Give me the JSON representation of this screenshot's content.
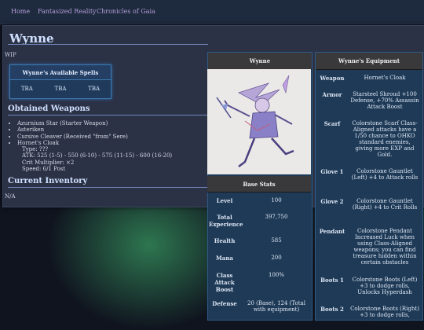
{
  "nav": {
    "items": [
      "Home",
      "Fantasized Reality",
      "Chronicles of Gaia"
    ]
  },
  "page": {
    "title": "Wynne",
    "wip": "WIP",
    "spells": {
      "heading": "Wynne's Available Spells",
      "slots": [
        "TBA",
        "TBA",
        "TBA"
      ]
    },
    "weapons_heading": "Obtained Weapons",
    "weapons": [
      "Azurnium Star (Starter Weapon)",
      "Asteriken",
      "Cursive Cleaver (Received \"from\" Sere)",
      "Hornet's Cloak"
    ],
    "weapon_details": [
      "Type: ???",
      "ATK: 525 (1-5) - 550 (6-10) - 575 (11-15) - 600 (16-20)",
      "Crit Multiplier: ×2",
      "Speed: 6/1 Post"
    ],
    "inventory_heading": "Current Inventory",
    "inventory_value": "N/A"
  },
  "character": {
    "heading": "Wynne",
    "stats_heading": "Base Stats",
    "stats": [
      {
        "label": "Level",
        "value": "100"
      },
      {
        "label": "Total Experience",
        "value": "397,750"
      },
      {
        "label": "Health",
        "value": "585"
      },
      {
        "label": "Mana",
        "value": "200"
      },
      {
        "label": "Class Attack Boost",
        "value": "100%"
      },
      {
        "label": "Defense",
        "value": "20 (Base), 124 (Total with equipment)"
      }
    ]
  },
  "equipment": {
    "heading": "Wynne's Equipment",
    "rows": [
      {
        "label": "Weapon",
        "value": "Hornet's Cloak"
      },
      {
        "label": "Armor",
        "value": "Starsteel Shroud +100 Defense, +70% Assassin Attack Boost"
      },
      {
        "label": "Scarf",
        "value": "Colorstone Scarf Class-Aligned attacks have a 1/50 chance to OHKO standard enemies, giving more EXP and Gold."
      },
      {
        "label": "Glove 1",
        "value": "Colorstone Gauntlet (Left) +4 to Attack rolls"
      },
      {
        "label": "Glove 2",
        "value": "Colorstone Gauntlet (Right) +4 to Crit Rolls"
      },
      {
        "label": "Pendant",
        "value": "Colorstone Pendant Increased Luck when using Class-Aligned weapons; you can find treasure hidden within certain obstacles"
      },
      {
        "label": "Boots 1",
        "value": "Colorstone Boots (Left) +3 to dodge rolls, Unlocks Hyperdash"
      },
      {
        "label": "Boots 2",
        "value": "Colorstone Boots (Right) +3 to dodge rolls,"
      }
    ]
  }
}
